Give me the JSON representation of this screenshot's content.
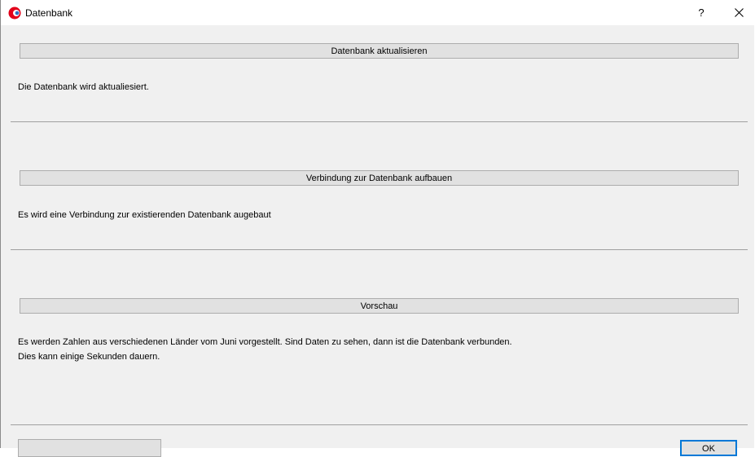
{
  "window": {
    "title": "Datenbank",
    "help_label": "?",
    "close_label": "✕",
    "app_icon": "app-logo-icon",
    "accent_color": "#0078d7"
  },
  "sections": [
    {
      "button_label": "Datenbank aktualisieren",
      "description": "Die Datenbank wird aktualiesiert."
    },
    {
      "button_label": "Verbindung zur Datenbank aufbauen",
      "description": "Es wird eine Verbindung zur existierenden Datenbank augebaut"
    },
    {
      "button_label": "Vorschau",
      "description_line1": "Es werden Zahlen aus verschiedenen Länder vom Juni vorgestellt. Sind Daten zu sehen, dann ist die Datenbank verbunden.",
      "description_line2": "Dies kann einige Sekunden dauern."
    }
  ],
  "footer": {
    "ok_label": "OK"
  }
}
